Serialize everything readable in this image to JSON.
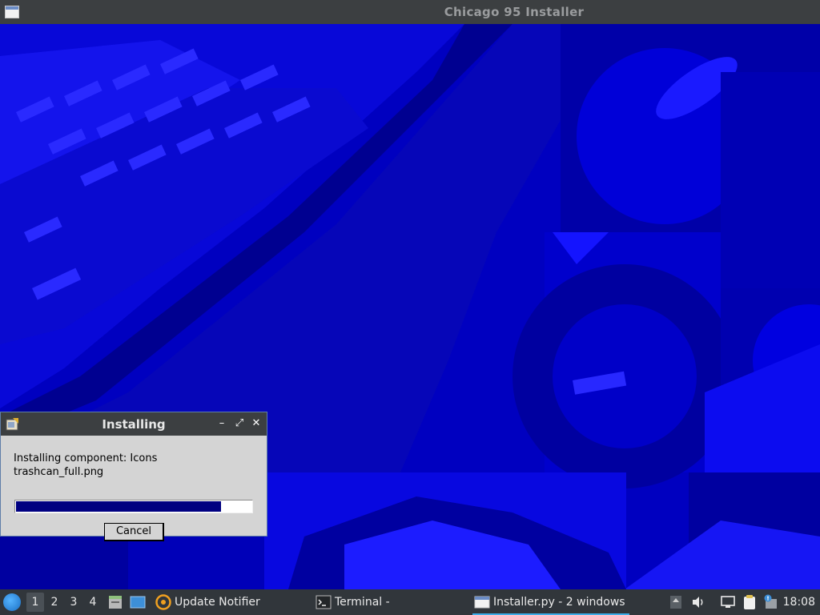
{
  "window": {
    "title": "Chicago 95 Installer"
  },
  "dialog": {
    "title": "Installing",
    "status_line": "Installing component: Icons",
    "file_line": "trashcan_full.png",
    "progress_fraction": 0.87,
    "cancel_label": "Cancel",
    "minimize_glyph": "–",
    "maximize_glyph": "⤢",
    "close_glyph": "✕"
  },
  "taskbar": {
    "workspaces": [
      "1",
      "2",
      "3",
      "4"
    ],
    "active_workspace": "1",
    "tasks": [
      {
        "label": "Update Notifier",
        "icon": "update-notifier-icon"
      },
      {
        "label": "Terminal -",
        "icon": "terminal-icon"
      },
      {
        "label": "Installer.py - 2 windows",
        "icon": "window-icon",
        "active": true
      }
    ],
    "clock": "18:08"
  },
  "colors": {
    "wallpaper": "#0000c8",
    "titlebar": "#3c3f41",
    "dialog_bg": "#d4d4d4",
    "progress": "#000080",
    "taskbar": "#31363b",
    "accent": "#3daee9"
  }
}
